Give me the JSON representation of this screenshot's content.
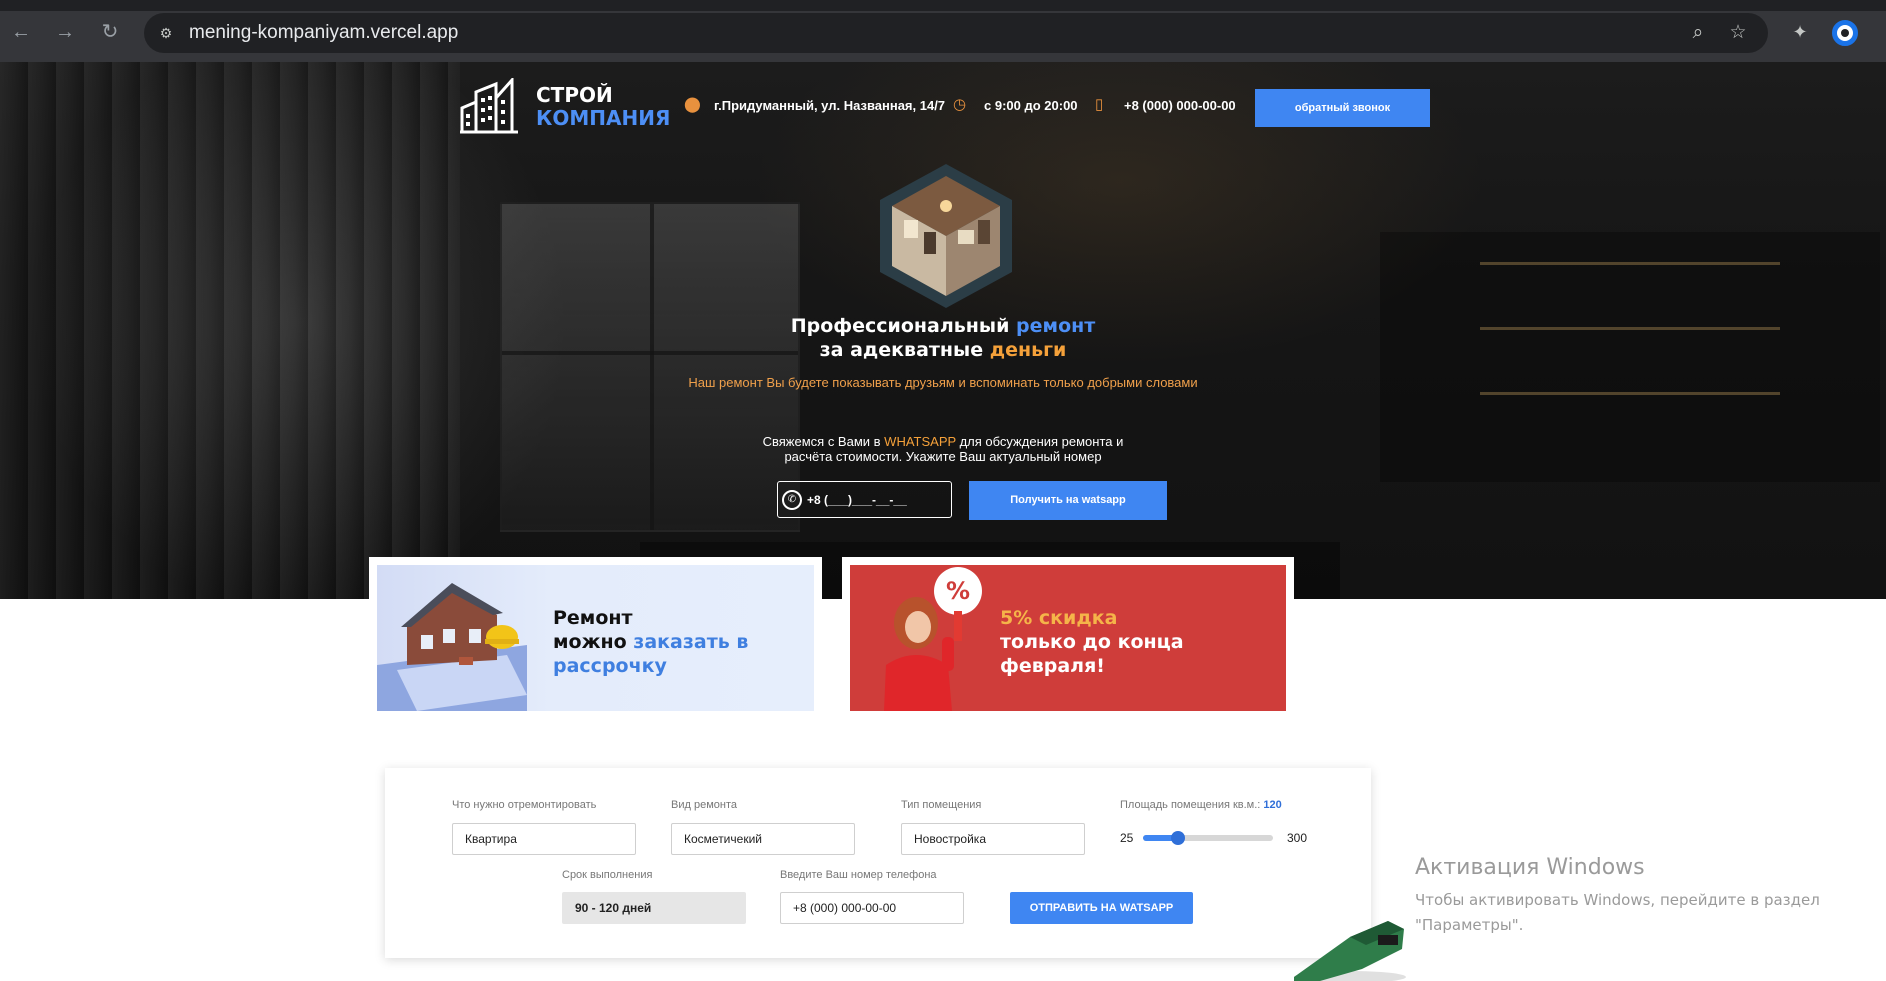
{
  "browser": {
    "url": "mening-kompaniyam.vercel.app",
    "icons": {
      "back": "arrow-left-icon",
      "forward": "arrow-right-icon",
      "reload": "reload-icon",
      "site_info": "tune-icon",
      "zoom": "zoom-icon",
      "bookmark": "star-icon",
      "extension": "extension-icon",
      "profile": "profile-icon"
    }
  },
  "header": {
    "logo_line1": "СТРОЙ",
    "logo_line2": "КОМПАНИЯ",
    "address": "г.Придуманный, ул. Названная, 14/7",
    "hours": "с 9:00 до 20:00",
    "phone": "+8 (000) 000-00-00",
    "callback_label": "обратный звонок"
  },
  "hero": {
    "headline_part1": "Профессиональный",
    "headline_accent1": "ремонт",
    "headline_part2": "за адекватные",
    "headline_accent2": "деньги",
    "subline": "Наш ремонт Вы будете показывать друзьям и вспоминать только добрыми словами",
    "contact_part1": "Свяжемся с Вами в",
    "contact_accent": "WHATSAPP",
    "contact_part2": "для обсуждения ремонта и расчёта стоимости. Укажите Ваш актуальный номер",
    "phone_mask": "+8 (___)___-__-__",
    "whatsapp_btn": "Получить на watsapp"
  },
  "promos": {
    "installment_line1": "Ремонт",
    "installment_line2": "можно",
    "installment_accent": "заказать в рассрочку",
    "discount_accent": "5% скидка",
    "discount_line": "только до конца февраля!"
  },
  "calculator": {
    "what_label": "Что нужно отремонтировать",
    "what_value": "Квартира",
    "type_label": "Вид ремонта",
    "type_value": "Косметичекий",
    "room_label": "Тип помещения",
    "room_value": "Новостройка",
    "area_label": "Площадь помещения кв.м.:",
    "area_value": "120",
    "area_min": "25",
    "area_max": "300",
    "area_fraction": 0.27,
    "term_label": "Срок выполнения",
    "term_value": "90 - 120 дней",
    "phone_label": "Введите Ваш номер телефона",
    "phone_placeholder": "+8 (000) 000-00-00",
    "submit_label": "ОТПРАВИТЬ НА WATSAPP"
  },
  "windows": {
    "title": "Активация Windows",
    "subtitle": "Чтобы активировать Windows, перейдите в раздел \"Параметры\"."
  },
  "colors": {
    "accent_blue": "#3f86f2",
    "accent_orange": "#f5a13a",
    "promo_red": "#cf3d3a"
  }
}
